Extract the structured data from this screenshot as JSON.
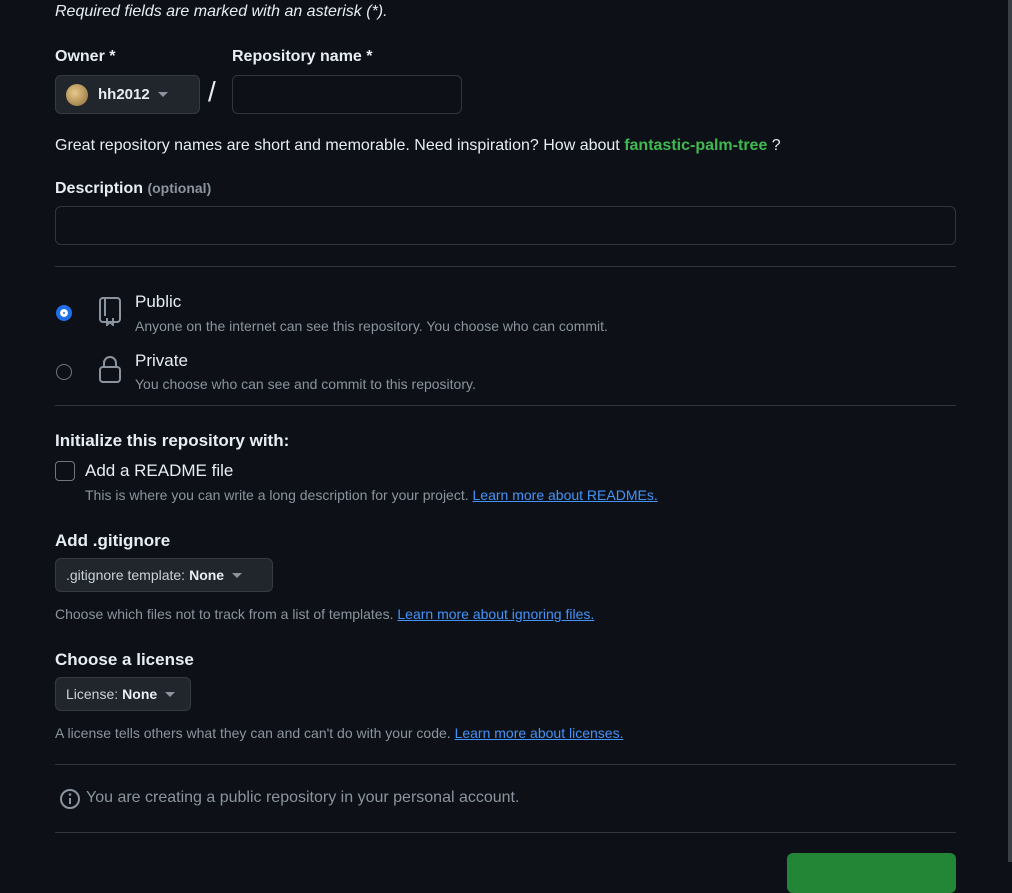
{
  "form": {
    "required_note": "Required fields are marked with an asterisk (*).",
    "owner_label": "Owner *",
    "owner_value": "hh2012",
    "slash": "/",
    "repo_name_label": "Repository name *",
    "repo_name_value": "",
    "hint_prefix": "Great repository names are short and memorable. Need inspiration? How about",
    "hint_suggestion": "fantastic-palm-tree",
    "hint_suffix": "?",
    "description_label": "Description",
    "description_optional": "(optional)",
    "description_value": ""
  },
  "visibility": {
    "public_title": "Public",
    "public_desc": "Anyone on the internet can see this repository. You choose who can commit.",
    "private_title": "Private",
    "private_desc": "You choose who can see and commit to this repository.",
    "selected": "public"
  },
  "init": {
    "title": "Initialize this repository with:",
    "readme_label": "Add a README file",
    "readme_desc": "This is where you can write a long description for your project.",
    "readme_link": "Learn more about READMEs."
  },
  "gitignore": {
    "title": "Add .gitignore",
    "button_prefix": ".gitignore template:",
    "button_value": "None",
    "desc": "Choose which files not to track from a list of templates.",
    "link": "Learn more about ignoring files."
  },
  "license": {
    "title": "Choose a license",
    "button_prefix": "License:",
    "button_value": "None",
    "desc": "A license tells others what they can and can't do with your code.",
    "link": "Learn more about licenses."
  },
  "footer": {
    "info": "You are creating a public repository in your personal account."
  },
  "colors": {
    "bg": "#0d1117",
    "accent_green": "#3fb950",
    "link_blue": "#4493f8",
    "radio_blue": "#1f6feb",
    "create_button": "#238636"
  }
}
